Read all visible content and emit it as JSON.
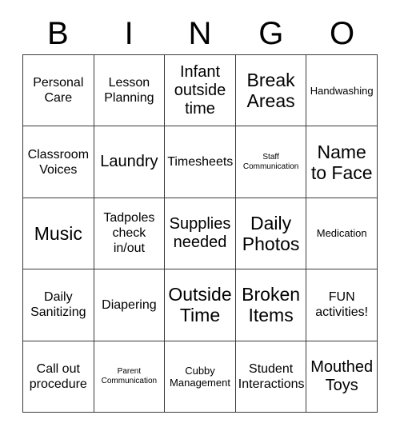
{
  "header": {
    "letters": [
      "B",
      "I",
      "N",
      "G",
      "O"
    ]
  },
  "grid": {
    "columns": 5,
    "rows": 5,
    "cells": [
      {
        "text": "Personal\nCare",
        "size": "md"
      },
      {
        "text": "Lesson\nPlanning",
        "size": "md"
      },
      {
        "text": "Infant\noutside\ntime",
        "size": "lg"
      },
      {
        "text": "Break\nAreas",
        "size": "xl"
      },
      {
        "text": "Handwashing",
        "size": "sm"
      },
      {
        "text": "Classroom\nVoices",
        "size": "md"
      },
      {
        "text": "Laundry",
        "size": "lg"
      },
      {
        "text": "Timesheets",
        "size": "md"
      },
      {
        "text": "Staff\nCommunication",
        "size": "xs"
      },
      {
        "text": "Name\nto Face",
        "size": "xl"
      },
      {
        "text": "Music",
        "size": "xl"
      },
      {
        "text": "Tadpoles\ncheck\nin/out",
        "size": "md"
      },
      {
        "text": "Supplies\nneeded",
        "size": "lg"
      },
      {
        "text": "Daily\nPhotos",
        "size": "xl"
      },
      {
        "text": "Medication",
        "size": "sm"
      },
      {
        "text": "Daily\nSanitizing",
        "size": "md"
      },
      {
        "text": "Diapering",
        "size": "md"
      },
      {
        "text": "Outside\nTime",
        "size": "xl"
      },
      {
        "text": "Broken\nItems",
        "size": "xl"
      },
      {
        "text": "FUN\nactivities!",
        "size": "md"
      },
      {
        "text": "Call out\nprocedure",
        "size": "md"
      },
      {
        "text": "Parent\nCommunication",
        "size": "xs"
      },
      {
        "text": "Cubby\nManagement",
        "size": "sm"
      },
      {
        "text": "Student\nInteractions",
        "size": "md"
      },
      {
        "text": "Mouthed\nToys",
        "size": "lg"
      }
    ]
  },
  "colors": {
    "background": "#ffffff",
    "border": "#3a3a3a",
    "text": "#000000"
  }
}
